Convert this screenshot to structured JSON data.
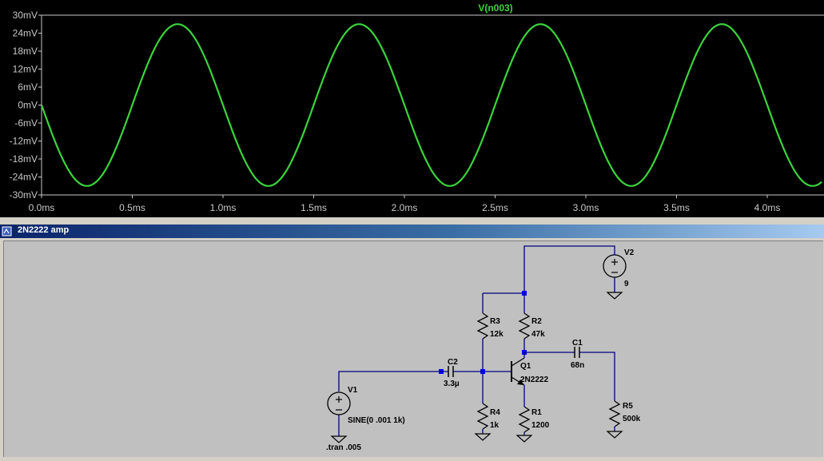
{
  "plot": {
    "trace_name": "V(n003)",
    "y_ticks": [
      "30mV",
      "24mV",
      "18mV",
      "12mV",
      "6mV",
      "0mV",
      "-6mV",
      "-12mV",
      "-18mV",
      "-24mV",
      "-30mV"
    ],
    "x_ticks": [
      "0.0ms",
      "0.5ms",
      "1.0ms",
      "1.5ms",
      "2.0ms",
      "2.5ms",
      "3.0ms",
      "3.5ms",
      "4.0ms"
    ],
    "colors": {
      "background": "#000000",
      "trace": "#3cd43c",
      "axis": "#c8c8c8"
    }
  },
  "chart_data": {
    "type": "line",
    "series": [
      {
        "name": "V(n003)",
        "amplitude_mV": 27,
        "frequency_kHz": 1,
        "phase_deg": 180
      }
    ],
    "x_unit": "ms",
    "y_unit": "mV",
    "xlim": [
      0,
      4.3
    ],
    "ylim": [
      -30,
      30
    ]
  },
  "schematic": {
    "window_title": "2N2222 amp",
    "components": {
      "v1": {
        "name": "V1",
        "value": "SINE(0 .001 1k)"
      },
      "v2": {
        "name": "V2",
        "value": "9"
      },
      "c1": {
        "name": "C1",
        "value": "68n"
      },
      "c2": {
        "name": "C2",
        "value": "3.3µ"
      },
      "q1": {
        "name": "Q1",
        "value": "2N2222"
      },
      "r1": {
        "name": "R1",
        "value": "1200"
      },
      "r2": {
        "name": "R2",
        "value": "47k"
      },
      "r3": {
        "name": "R3",
        "value": "12k"
      },
      "r4": {
        "name": "R4",
        "value": "1k"
      },
      "r5": {
        "name": "R5",
        "value": "500k"
      }
    },
    "directive": ".tran .005"
  }
}
